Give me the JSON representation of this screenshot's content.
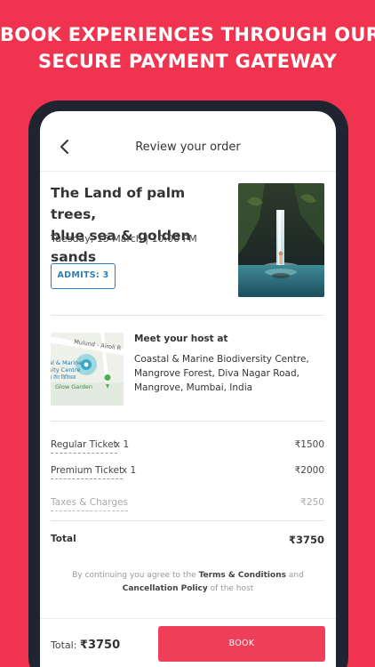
{
  "promo": {
    "line1": "BOOK EXPERIENCES THROUGH OUR",
    "line2": "SECURE PAYMENT GATEWAY"
  },
  "header": {
    "title": "Review your order",
    "back_icon": "chevron-left-icon"
  },
  "experience": {
    "title_line1": "The Land of palm trees,",
    "title_line2": "blue sea & golden sands",
    "date": "Tuesday, 15 March | 10:00 PM",
    "admits_label": "ADMITS: 3",
    "photo": "waterfall-photo"
  },
  "host": {
    "heading": "Meet your host at",
    "address": "Coastal & Marine Biodiversity Centre, Mangrove Forest, Diva Nagar Road, Mangrove, Mumbai, India",
    "map": {
      "road_label": "Mulund - Airoli R",
      "place_label_1": "al & Marine",
      "place_label_2": "sity Centre",
      "place_label_3": "त्र जैव विविधता",
      "poi_label": "Glow Garden"
    }
  },
  "pricing": {
    "regular": {
      "label": "Regular Ticket",
      "qty": "x 1",
      "amount": "₹1500"
    },
    "premium": {
      "label": "Premium Ticket",
      "qty": "x 1",
      "amount": "₹2000"
    },
    "taxes": {
      "label": "Taxes & Charges",
      "amount": "₹250"
    },
    "total": {
      "label": "Total",
      "amount": "₹3750"
    }
  },
  "terms": {
    "prefix": "By continuing you agree to the",
    "link1": "Terms & Conditions",
    "middle": "and",
    "link2": "Cancellation Policy",
    "suffix": "of the host"
  },
  "footer": {
    "total_label": "Total:",
    "total_value": "₹3750",
    "book_label": "BOOK"
  },
  "colors": {
    "brand": "#f0344f",
    "button": "#ef3f58",
    "accent_blue": "#2d7fb8",
    "device": "#1f2430"
  }
}
